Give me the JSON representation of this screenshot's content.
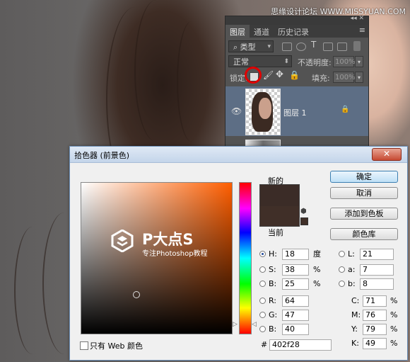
{
  "watermark": "思缘设计论坛 WWW.MISSYUAN.COM",
  "layers_panel": {
    "tabs": [
      "图层",
      "通道",
      "历史记录"
    ],
    "filter_kind": "类型",
    "blend_mode": "正常",
    "opacity_label": "不透明度:",
    "opacity_value": "100%",
    "lock_label": "锁定:",
    "fill_label": "填充:",
    "fill_value": "100%",
    "layer_name": "图层 1"
  },
  "dialog": {
    "title": "拾色器 (前景色)",
    "new_label": "新的",
    "current_label": "当前",
    "buttons": {
      "ok": "确定",
      "cancel": "取消",
      "add_swatch": "添加到色板",
      "color_library": "颜色库"
    },
    "logo": {
      "brand": "P大点S",
      "tagline": "专注Photoshop教程"
    },
    "fields": {
      "H": "18",
      "S": "38",
      "B": "25",
      "R": "64",
      "G": "47",
      "Bb": "40",
      "L": "21",
      "a": "7",
      "b": "8",
      "C": "71",
      "M": "76",
      "Y": "79",
      "K": "49"
    },
    "labels": {
      "H": "H:",
      "S": "S:",
      "B": "B:",
      "R": "R:",
      "G": "G:",
      "Bb": "B:",
      "L": "L:",
      "a": "a:",
      "b": "b:",
      "C": "C:",
      "M": "M:",
      "Y": "Y:",
      "K": "K:"
    },
    "units": {
      "degree": "度",
      "percent": "%"
    },
    "hex_label": "#",
    "hex": "402f28",
    "web_only_label": "只有 Web 颜色"
  },
  "colors": {
    "new": "#3b2c27",
    "current": "#402f28",
    "hue_base": "#ff5e00"
  }
}
